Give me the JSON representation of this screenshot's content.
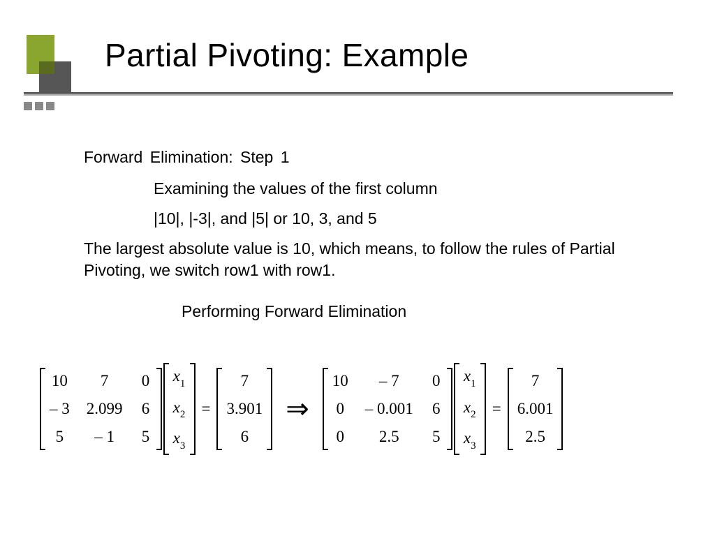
{
  "title": "Partial Pivoting: Example",
  "body": {
    "step": "Forward  Elimination: Step 1",
    "examining": "Examining the values of the first column",
    "abs_line": "|10|, |-3|, and |5| or 10, 3, and 5",
    "largest": "The largest absolute value is 10, which means, to follow the rules of Partial Pivoting, we switch row1 with row1.",
    "performing": "Performing Forward Elimination"
  },
  "eqs": {
    "A1": [
      [
        "10",
        "7",
        "0"
      ],
      [
        "– 3",
        "2.099",
        "6"
      ],
      [
        "5",
        "– 1",
        "5"
      ]
    ],
    "x": [
      "x1",
      "x2",
      "x3"
    ],
    "b1": [
      "7",
      "3.901",
      "6"
    ],
    "A2": [
      [
        "10",
        "– 7",
        "0"
      ],
      [
        "0",
        "– 0.001",
        "6"
      ],
      [
        "0",
        "2.5",
        "5"
      ]
    ],
    "b2": [
      "7",
      "6.001",
      "2.5"
    ],
    "equals": "=",
    "arrow": "⇒"
  }
}
